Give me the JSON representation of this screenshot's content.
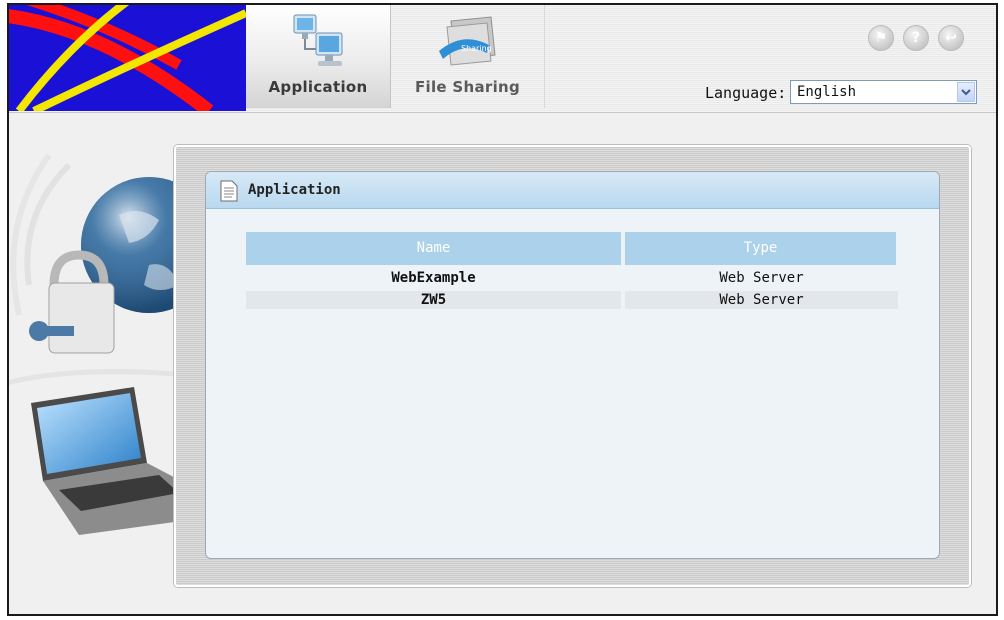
{
  "header": {
    "tabs": [
      {
        "label": "Application",
        "icon": "network-computers-icon",
        "active": true
      },
      {
        "label": "File Sharing",
        "icon": "sharing-folder-icon",
        "active": false
      }
    ],
    "round_buttons": [
      "home-icon",
      "help-icon",
      "logout-icon"
    ],
    "language": {
      "label": "Language:",
      "value": "English"
    }
  },
  "panel": {
    "title": "Application",
    "table": {
      "columns": [
        "Name",
        "Type"
      ],
      "rows": [
        {
          "name": "WebExample",
          "type": "Web Server"
        },
        {
          "name": "ZW5",
          "type": "Web Server"
        }
      ]
    }
  },
  "colors": {
    "logo_background": "#1b10d6",
    "table_header": "#acd1ea",
    "title_bar": "#b9d8ef"
  }
}
